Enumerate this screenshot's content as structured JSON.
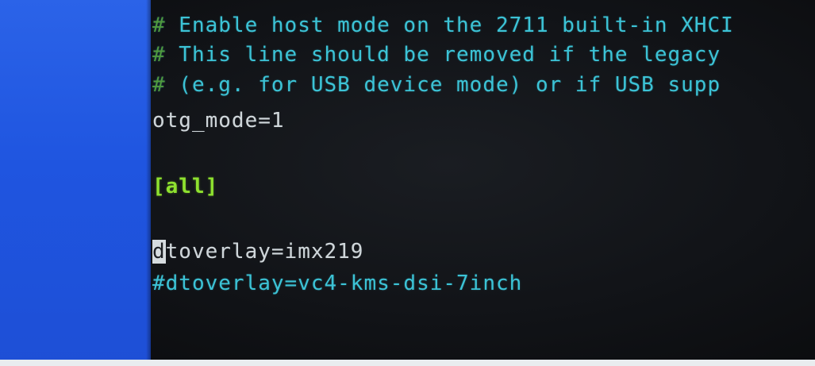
{
  "colors": {
    "left_band": "#2b63e8",
    "comment_hash": "#4f9b3e",
    "comment_text": "#3cc3d6",
    "plain_text": "#cfd6da",
    "section_header": "#8ee12f",
    "background": "#111317"
  },
  "terminal": {
    "comment_marker": "#",
    "line1_text": " Enable host mode on the 2711 built-in XHCI",
    "line2_text": " This line should be removed if the legacy",
    "line3_text": " (e.g. for USB device mode) or if USB supp",
    "otg_mode": "otg_mode=1",
    "section_all": "[all]",
    "cursor_char": "d",
    "dtoverlay_rest": "toverlay=imx219",
    "dtoverlay_commented": "#dtoverlay=vc4-kms-dsi-7inch"
  }
}
